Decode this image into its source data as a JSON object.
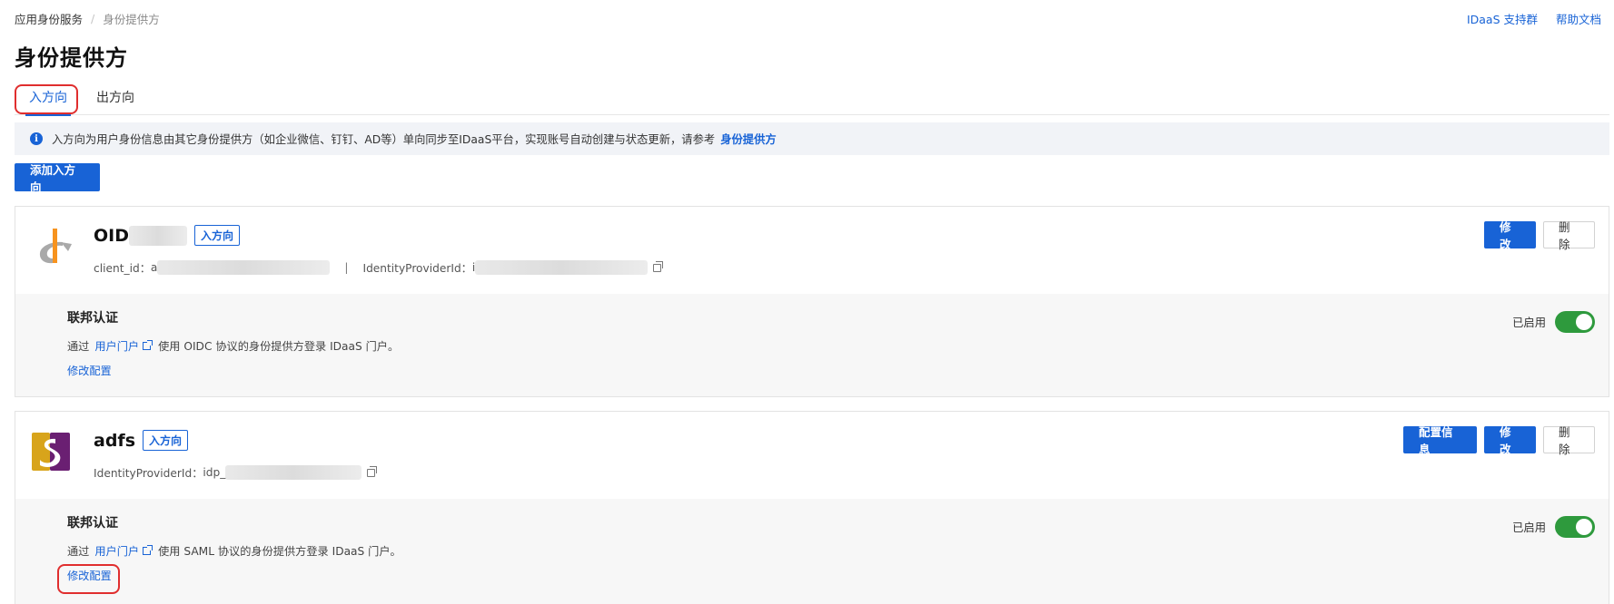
{
  "breadcrumb": {
    "root": "应用身份服务",
    "separator": "/",
    "current": "身份提供方"
  },
  "top_links": {
    "support": "IDaaS 支持群",
    "docs": "帮助文档"
  },
  "page": {
    "title": "身份提供方"
  },
  "tabs": [
    {
      "label": "入方向",
      "active": true
    },
    {
      "label": "出方向",
      "active": false
    }
  ],
  "info": {
    "text": "入方向为用户身份信息由其它身份提供方（如企业微信、钉钉、AD等）单向同步至IDaaS平台，实现账号自动创建与状态更新，请参考",
    "link": "身份提供方"
  },
  "add_button": "添加入方向",
  "providers": [
    {
      "name": "OID",
      "tag": "入方向",
      "meta_client_label": "client_id：",
      "meta_client_value": "a",
      "meta_divider": "|",
      "meta_idp_label": "IdentityProviderId：",
      "meta_idp_value": "i",
      "actions": {
        "edit": "修改",
        "delete": "删除"
      },
      "federation": {
        "title": "联邦认证",
        "prefix": "通过",
        "link": "用户门户",
        "suffix": "使用 OIDC 协议的身份提供方登录 IDaaS 门户。",
        "edit": "修改配置",
        "status": "已启用"
      }
    },
    {
      "name": "adfs",
      "tag": "入方向",
      "meta_idp_label": "IdentityProviderId：",
      "meta_idp_value": "idp_",
      "actions": {
        "config": "配置信息",
        "edit": "修改",
        "delete": "删除"
      },
      "federation": {
        "title": "联邦认证",
        "prefix": "通过",
        "link": "用户门户",
        "suffix": "使用 SAML 协议的身份提供方登录 IDaaS 门户。",
        "edit": "修改配置",
        "status": "已启用"
      }
    }
  ],
  "colors": {
    "primary": "#1863d6",
    "toggle_on": "#2e9a3d",
    "highlight": "#e02e2e"
  }
}
